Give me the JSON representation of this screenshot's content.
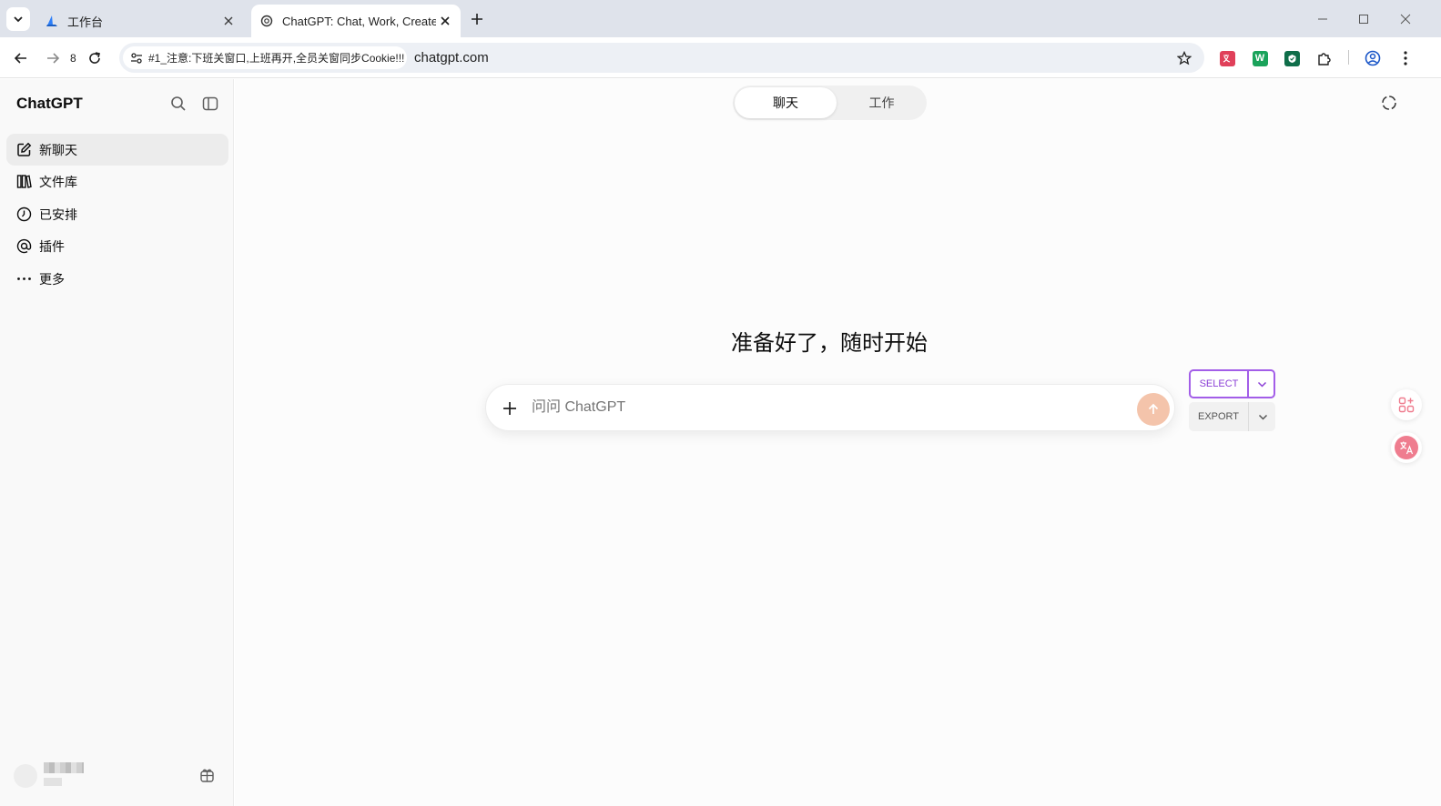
{
  "browser": {
    "tabs": [
      {
        "title": "工作台",
        "favicon": "blue-sail-icon",
        "active": false
      },
      {
        "title": "ChatGPT: Chat, Work, Create",
        "favicon": "openai-icon",
        "active": true
      }
    ],
    "history_count": "8",
    "site_chip_text": "#1_注意:下班关窗口,上班再开,全员关窗同步Cookie!!!",
    "url": "chatgpt.com",
    "extensions": [
      {
        "name": "translate-extension-icon",
        "label": "",
        "color": "#e0405a"
      },
      {
        "name": "w-extension-icon",
        "label": "W",
        "color": "#1aa35b"
      },
      {
        "name": "shield-extension-icon",
        "label": "",
        "color": "#0f6e4a"
      }
    ]
  },
  "sidebar": {
    "brand": "ChatGPT",
    "items": [
      {
        "label": "新聊天",
        "icon": "edit-icon"
      },
      {
        "label": "文件库",
        "icon": "library-icon"
      },
      {
        "label": "已安排",
        "icon": "clock-icon"
      },
      {
        "label": "插件",
        "icon": "at-icon"
      },
      {
        "label": "更多",
        "icon": "more-dots-icon"
      }
    ]
  },
  "main": {
    "mode_tabs": [
      "聊天",
      "工作"
    ],
    "headline": "准备好了，随时开始",
    "composer_placeholder": "问问 ChatGPT",
    "select_label": "SELECT",
    "export_label": "EXPORT",
    "accent_color": "#a35ee8",
    "send_color": "#f4c4ab"
  }
}
